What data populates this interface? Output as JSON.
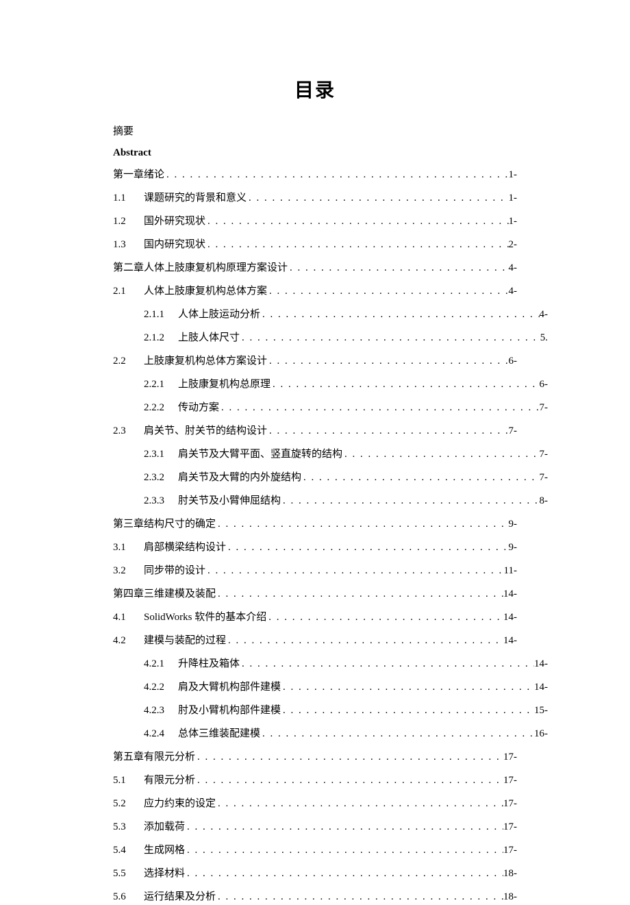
{
  "title": "目录",
  "front": {
    "abstract_cn": "摘要",
    "abstract_en": "Abstract"
  },
  "toc": [
    {
      "level": 1,
      "num": "",
      "label": "第一章绪论",
      "page": "1-"
    },
    {
      "level": 2,
      "num": "1.1",
      "label": "课题研究的背景和意义",
      "page": "1-"
    },
    {
      "level": 2,
      "num": "1.2",
      "label": "国外研究现状",
      "page": "1-"
    },
    {
      "level": 2,
      "num": "1.3",
      "label": "国内研究现状",
      "page": "2-"
    },
    {
      "level": 1,
      "num": "",
      "label": "第二章人体上肢康复机构原理方案设计",
      "page": "4-"
    },
    {
      "level": 2,
      "num": "2.1",
      "label": "人体上肢康复机构总体方案",
      "page": "4-"
    },
    {
      "level": 3,
      "num": "2.1.1",
      "label": "人体上肢运动分析",
      "page": "4-"
    },
    {
      "level": 3,
      "num": "2.1.2",
      "label": "上肢人体尺寸",
      "page": "5."
    },
    {
      "level": 2,
      "num": "2.2",
      "label": "上肢康复机构总体方案设计",
      "page": "6-"
    },
    {
      "level": 3,
      "num": "2.2.1",
      "label": "上肢康复机构总原理",
      "page": "6-"
    },
    {
      "level": 3,
      "num": "2.2.2",
      "label": "传动方案",
      "page": "7-"
    },
    {
      "level": 2,
      "num": "2.3",
      "label": "肩关节、肘关节的结构设计",
      "page": "7-"
    },
    {
      "level": 3,
      "num": "2.3.1",
      "label": "肩关节及大臂平面、竖直旋转的结构",
      "page": "7-"
    },
    {
      "level": 3,
      "num": "2.3.2",
      "label": "肩关节及大臂的内外旋结构",
      "page": "7-"
    },
    {
      "level": 3,
      "num": "2.3.3",
      "label": "肘关节及小臂伸屈结构",
      "page": "8-"
    },
    {
      "level": 1,
      "num": "",
      "label": "第三章结构尺寸的确定",
      "page": "9-"
    },
    {
      "level": 2,
      "num": "3.1",
      "label": "肩部横梁结构设计",
      "page": "9-"
    },
    {
      "level": 2,
      "num": "3.2",
      "label": "同步带的设计",
      "page": "11-"
    },
    {
      "level": 1,
      "num": "",
      "label": "第四章三维建模及装配",
      "page": "14-"
    },
    {
      "level": 2,
      "num": "4.1",
      "label": "SolidWorks 软件的基本介绍",
      "page": "14-",
      "latin": true
    },
    {
      "level": 2,
      "num": "4.2",
      "label": "建模与装配的过程",
      "page": "14-"
    },
    {
      "level": 3,
      "num": "4.2.1",
      "label": "升降柱及箱体",
      "page": "14-"
    },
    {
      "level": 3,
      "num": "4.2.2",
      "label": "肩及大臂机构部件建模",
      "page": "14-"
    },
    {
      "level": 3,
      "num": "4.2.3",
      "label": "肘及小臂机构部件建模",
      "page": "15-"
    },
    {
      "level": 3,
      "num": "4.2.4",
      "label": "总体三维装配建模",
      "page": "16-"
    },
    {
      "level": 1,
      "num": "",
      "label": "第五章有限元分析",
      "page": "17-"
    },
    {
      "level": 2,
      "num": "5.1",
      "label": "有限元分析",
      "page": "17-"
    },
    {
      "level": 2,
      "num": "5.2",
      "label": "应力约束的设定",
      "page": "17-"
    },
    {
      "level": 2,
      "num": "5.3",
      "label": "添加载荷",
      "page": "17-"
    },
    {
      "level": 2,
      "num": "5.4",
      "label": "生成网格",
      "page": "17-"
    },
    {
      "level": 2,
      "num": "5.5",
      "label": "选择材料",
      "page": "18-"
    },
    {
      "level": 2,
      "num": "5.6",
      "label": "运行结果及分析",
      "page": "18-"
    }
  ]
}
